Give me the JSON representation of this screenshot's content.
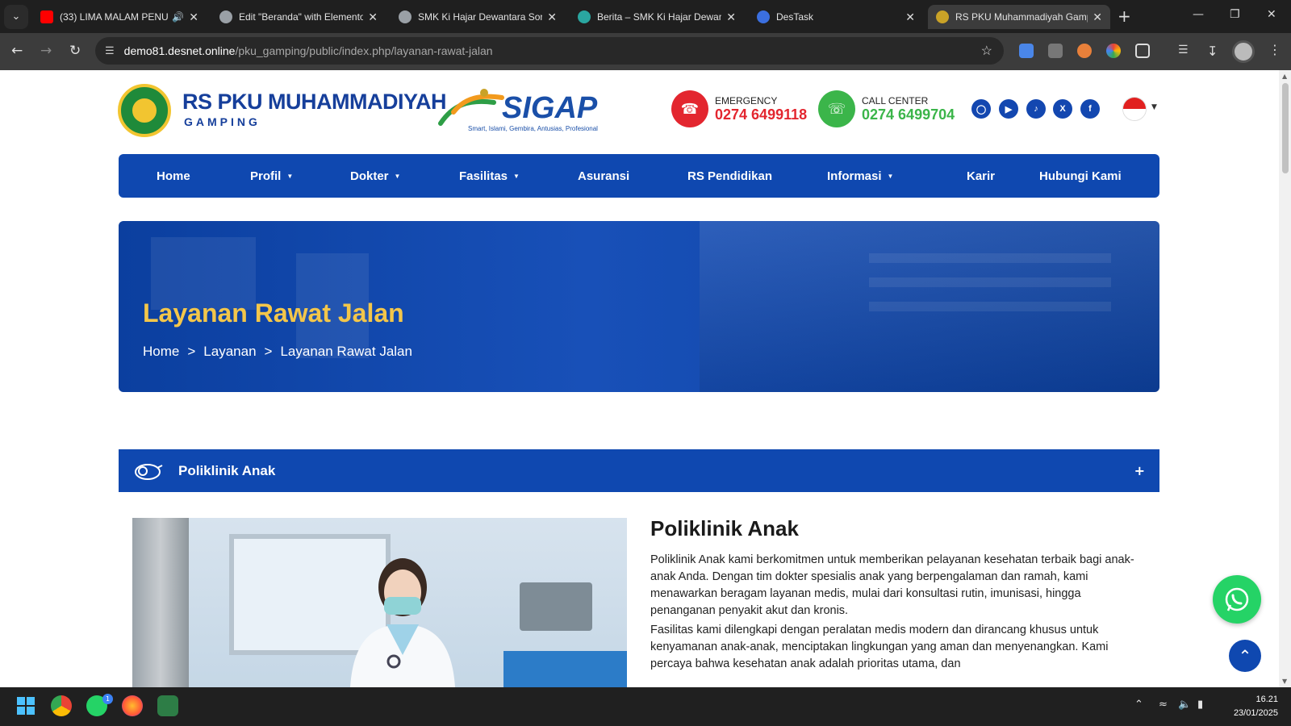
{
  "browser": {
    "tabs": [
      {
        "title": "(33) LIMA MALAM PENU",
        "favicon_color": "#ff0000",
        "audio": true
      },
      {
        "title": "Edit \"Beranda\" with Elementor",
        "favicon_color": "#9aa0a6"
      },
      {
        "title": "SMK Ki Hajar Dewantara Songgom",
        "favicon_color": "#9aa0a6"
      },
      {
        "title": "Berita – SMK Ki Hajar Dewantara",
        "favicon_color": "#2aa6a0"
      },
      {
        "title": "DesTask",
        "favicon_color": "#3b6fe0"
      },
      {
        "title": "RS PKU Muhammadiyah Gamping",
        "favicon_color": "#c9a227",
        "active": true
      }
    ],
    "url_host": "demo81.desnet.online",
    "url_path": "/pku_gamping/public/index.php/layanan-rawat-jalan"
  },
  "header": {
    "logo_title": "RS PKU MUHAMMADIYAH",
    "logo_subtitle": "GAMPING",
    "sigap_word": "SIGAP",
    "sigap_tagline": "Smart, Islami, Gembira, Antusias, Profesional",
    "emergency_label": "EMERGENCY",
    "emergency_number": "0274 6499118",
    "callcenter_label": "CALL CENTER",
    "callcenter_number": "0274 6499704",
    "social_icons": [
      "instagram-icon",
      "youtube-icon",
      "tiktok-icon",
      "x-icon",
      "facebook-icon"
    ],
    "language_flag": "indonesia-flag-icon"
  },
  "nav": {
    "items": [
      {
        "label": "Home",
        "dropdown": false
      },
      {
        "label": "Profil",
        "dropdown": true
      },
      {
        "label": "Dokter",
        "dropdown": true
      },
      {
        "label": "Fasilitas",
        "dropdown": true
      },
      {
        "label": "Asuransi",
        "dropdown": false
      },
      {
        "label": "RS Pendidikan",
        "dropdown": false
      },
      {
        "label": "Informasi",
        "dropdown": true
      },
      {
        "label": "Karir",
        "dropdown": false
      },
      {
        "label": "Hubungi Kami",
        "dropdown": false
      }
    ]
  },
  "hero": {
    "title": "Layanan Rawat Jalan",
    "breadcrumb": [
      "Home",
      "Layanan",
      "Layanan Rawat Jalan"
    ],
    "separator": ">"
  },
  "accordion": {
    "title": "Poliklinik Anak",
    "toggle": "+"
  },
  "content": {
    "title": "Poliklinik Anak",
    "paragraphs": [
      "Poliklinik Anak kami berkomitmen untuk memberikan pelayanan kesehatan terbaik bagi anak-anak Anda. Dengan tim dokter spesialis anak yang berpengalaman dan ramah, kami menawarkan beragam layanan medis, mulai dari konsultasi rutin, imunisasi, hingga penanganan penyakit akut dan kronis.",
      "Fasilitas kami dilengkapi dengan peralatan medis modern dan dirancang khusus untuk kenyamanan anak-anak, menciptakan lingkungan yang aman dan menyenangkan. Kami percaya bahwa kesehatan anak adalah prioritas utama, dan"
    ]
  },
  "colors": {
    "brand_blue": "#0f48b0",
    "hero_title_gold": "#f3c64a",
    "emergency_red": "#e3262f",
    "callcenter_green": "#3bb54a",
    "whatsapp_green": "#25d366"
  },
  "taskbar": {
    "time": "16.21",
    "date": "23/01/2025",
    "whatsapp_badge": "1"
  }
}
